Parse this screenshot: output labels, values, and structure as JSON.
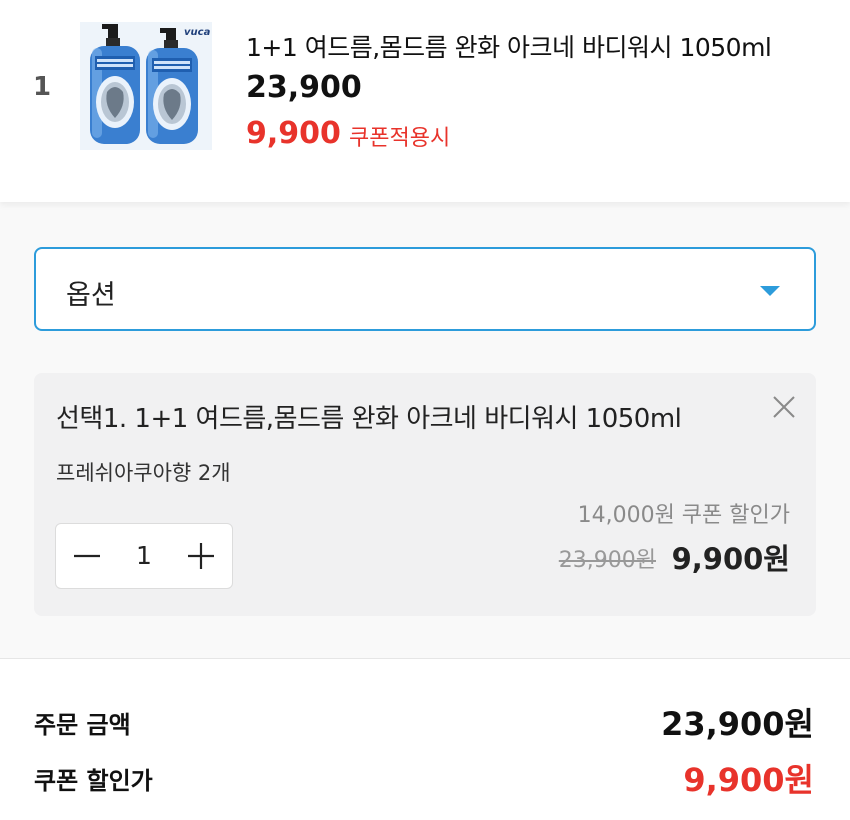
{
  "product": {
    "rank": "1",
    "title": "1+1 여드름,몸드름 완화 아크네 바디워시 1050ml",
    "price": "23,900",
    "sale_price": "9,900",
    "coupon_label": "쿠폰적용시",
    "thumbnail_brand": "vuca"
  },
  "option_select": {
    "label": "옵션"
  },
  "selected_option": {
    "title": "선택1. 1+1 여드름,몸드름 완화 아크네 바디워시 1050ml",
    "subtitle": "프레쉬아쿠아향 2개",
    "discount_note": "14,000원 쿠폰 할인가",
    "quantity": "1",
    "original_price": "23,900원",
    "final_price": "9,900원"
  },
  "summary": {
    "order_label": "주문 금액",
    "order_value": "23,900원",
    "coupon_label": "쿠폰 할인가",
    "coupon_value": "9,900원"
  },
  "colors": {
    "accent_blue": "#2d9cdb",
    "sale_red": "#e8332b"
  },
  "icons": [
    "close-icon",
    "minus-icon",
    "plus-icon",
    "chevron-down-icon"
  ]
}
